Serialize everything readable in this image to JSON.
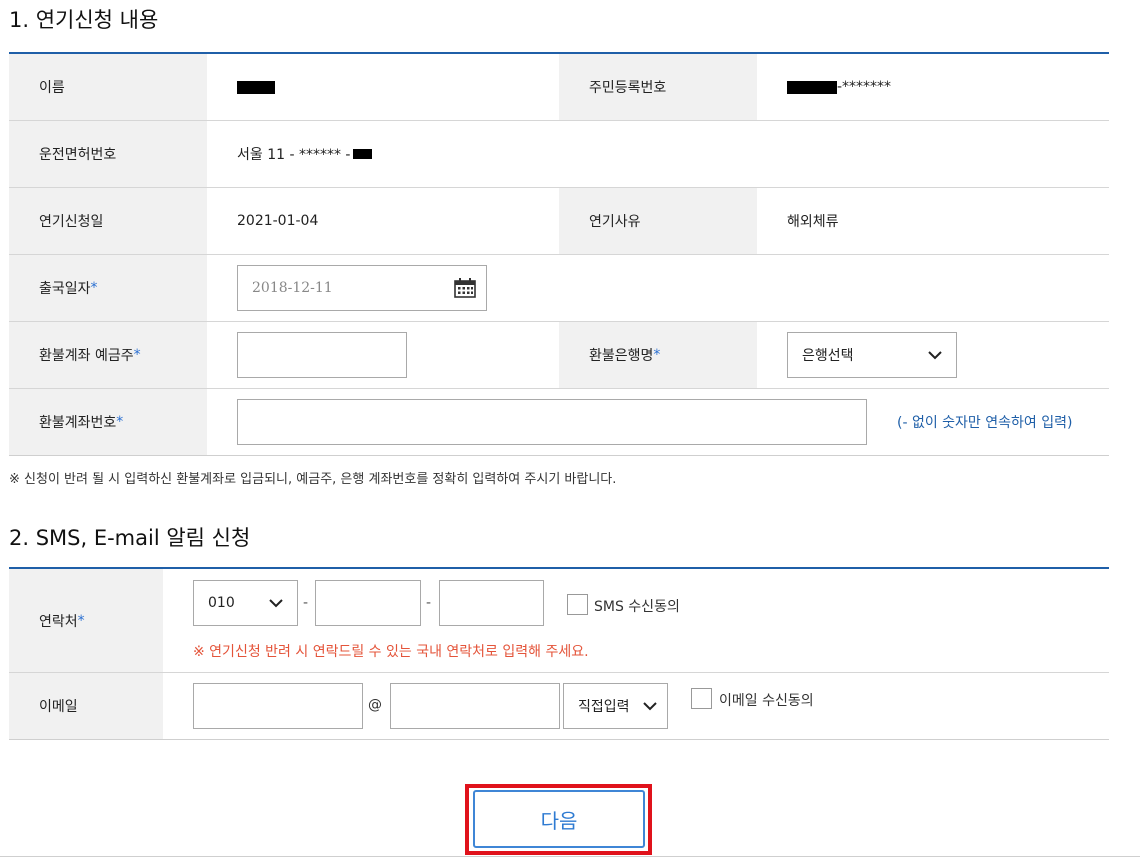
{
  "section1": {
    "title": "1. 연기신청 내용",
    "rows": {
      "name": {
        "label": "이름",
        "value_tail": ""
      },
      "rrn": {
        "label": "주민등록번호",
        "value_tail": "-*******"
      },
      "license": {
        "label": "운전면허번호",
        "value": "서울 11 - ****** -"
      },
      "apply_date": {
        "label": "연기신청일",
        "value": "2021-01-04"
      },
      "reason": {
        "label": "연기사유",
        "value": "해외체류"
      },
      "departure": {
        "label": "출국일자",
        "required": "*",
        "value": "2018-12-11"
      },
      "holder": {
        "label": "환불계좌 예금주",
        "required": "*",
        "value": ""
      },
      "bank": {
        "label": "환불은행명",
        "required": "*",
        "selected": "은행선택"
      },
      "account": {
        "label": "환불계좌번호",
        "required": "*",
        "value": "",
        "hint": "(- 없이 숫자만 연속하여 입력)"
      }
    },
    "note": "※ 신청이 반려 될 시 입력하신 환불계좌로 입금되니, 예금주, 은행 계좌번호를 정확히 입력하여 주시기 바랍니다."
  },
  "section2": {
    "title": "2. SMS, E-mail 알림 신청",
    "contact": {
      "label": "연락처",
      "required": "*",
      "prefix": "010",
      "sep": "-",
      "sms_consent": "SMS 수신동의",
      "warning": "※ 연기신청 반려 시 연락드릴 수 있는 국내 연락처로 입력해 주세요."
    },
    "email": {
      "label": "이메일",
      "at": "@",
      "domain_select": "직접입력",
      "email_consent": "이메일 수신동의"
    }
  },
  "actions": {
    "next": "다음"
  },
  "colors": {
    "accent": "#1f5fa8",
    "warning": "#e4543a",
    "highlight": "#e0121b",
    "button_text": "#2f7bd2"
  },
  "icons": {
    "calendar": "calendar-icon",
    "chevron": "chevron-down-icon"
  }
}
